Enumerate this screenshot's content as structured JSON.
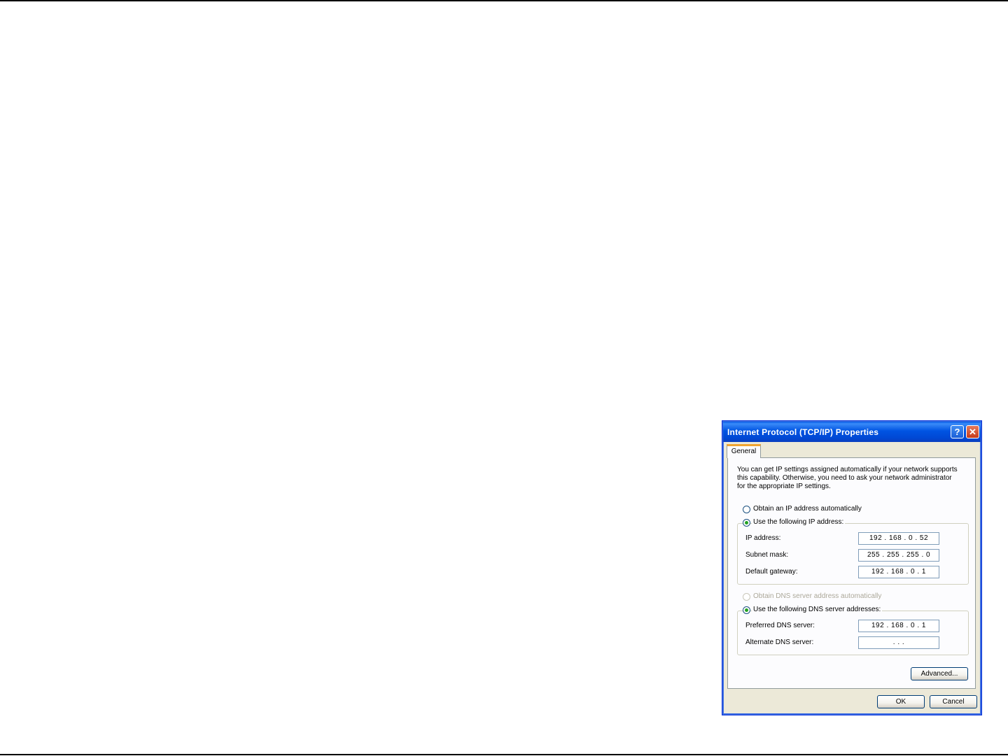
{
  "dialog": {
    "title": "Internet Protocol (TCP/IP) Properties",
    "help_glyph": "?",
    "close_glyph": "✕",
    "tab_general": "General",
    "description": "You can get IP settings assigned automatically if your network supports this capability. Otherwise, you need to ask your network administrator for the appropriate IP settings.",
    "ip_mode": {
      "auto_label": "Obtain an IP address automatically",
      "manual_label": "Use the following IP address:",
      "selected": "manual"
    },
    "ip_address_label": "IP address:",
    "ip_address_value": "192 . 168 .  0  . 52",
    "subnet_mask_label": "Subnet mask:",
    "subnet_mask_value": "255 . 255 . 255 .  0",
    "default_gateway_label": "Default gateway:",
    "default_gateway_value": "192 . 168 .  0  .  1",
    "dns_mode": {
      "auto_label": "Obtain DNS server address automatically",
      "manual_label": "Use the following DNS server addresses:",
      "selected": "manual"
    },
    "preferred_dns_label": "Preferred DNS server:",
    "preferred_dns_value": "192 . 168 .  0  .  1",
    "alternate_dns_label": "Alternate DNS server:",
    "alternate_dns_value": " .       .       . ",
    "advanced_label": "Advanced...",
    "ok_label": "OK",
    "cancel_label": "Cancel"
  }
}
